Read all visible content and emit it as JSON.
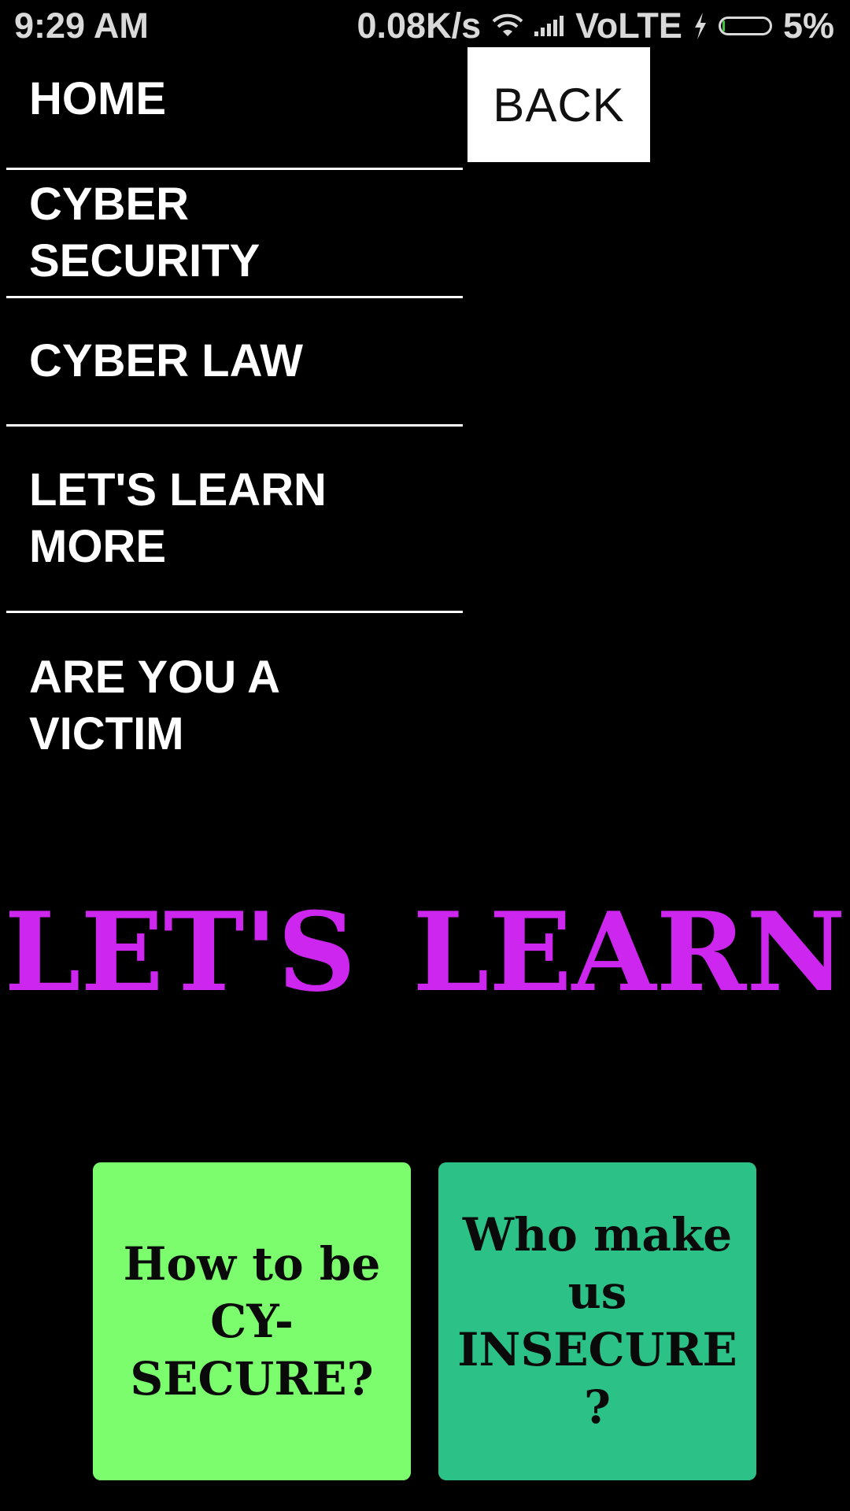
{
  "status_bar": {
    "time": "9:29 AM",
    "network_speed": "0.08K/s",
    "wifi_icon": "wifi-icon",
    "signal_icon": "signal-bars-icon",
    "network_type": "VoLTE",
    "charging_icon": "lightning-bolt-icon",
    "battery_icon": "battery-icon",
    "battery_level": 0.05,
    "battery_percent": "5%"
  },
  "back_button": {
    "label": "BACK"
  },
  "nav": {
    "items": [
      {
        "label": "HOME"
      },
      {
        "label": "CYBER SECURITY"
      },
      {
        "label": "CYBER LAW"
      },
      {
        "label": "LET'S LEARN MORE"
      },
      {
        "label": "ARE YOU A VICTIM"
      }
    ]
  },
  "hero": {
    "title": "LET'S LEARN"
  },
  "cards": [
    {
      "label": "How to be CY-SECURE?",
      "color": "#7cfd6d"
    },
    {
      "label": "Who make us INSECURE ?",
      "color": "#2bc187"
    }
  ],
  "colors": {
    "background": "#000000",
    "hero_title": "#cd26ee",
    "back_button_bg": "#ffffff",
    "nav_text": "#ffffff",
    "battery_fill": "#3ec23e"
  }
}
